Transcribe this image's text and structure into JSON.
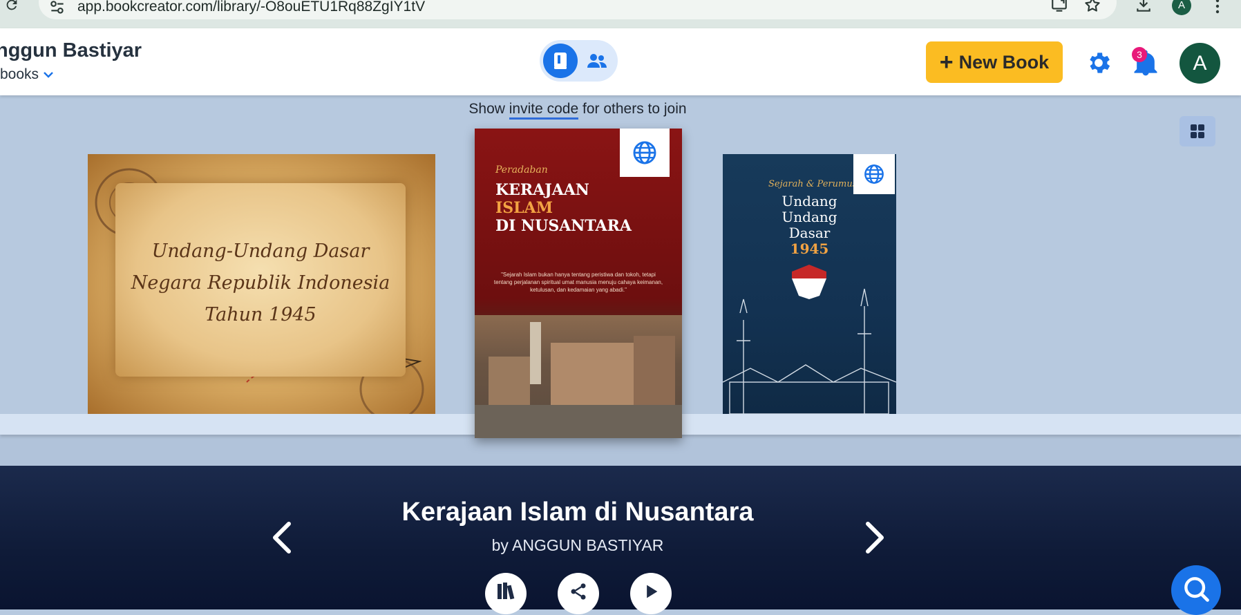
{
  "browser": {
    "url": "app.bookcreator.com/library/-O8ouETU1Rq88ZgIY1tV",
    "profile_initial": "A",
    "icons": [
      "reload-icon",
      "tune-icon",
      "cast-icon",
      "star-icon",
      "download-icon",
      "kebab-menu-icon"
    ]
  },
  "header": {
    "owner_name": "nggun Bastiyar",
    "library_filter": "books",
    "view_toggle": [
      "books-view-icon",
      "people-view-icon"
    ],
    "new_book_label": "New Book",
    "new_book_plus": "+",
    "notification_count": "3",
    "avatar_initial": "A"
  },
  "shelf": {
    "invite_prefix": "Show ",
    "invite_link": "invite code",
    "invite_suffix": " for others to join",
    "books": [
      {
        "cover_lines": [
          "Undang-Undang Dasar",
          "Negara Republik Indonesia",
          "Tahun 1945"
        ]
      },
      {
        "kicker": "Peradaban",
        "title_lines": [
          "KERAJAAN",
          "ISLAM",
          "DI NUSANTARA"
        ],
        "quote": "\"Sejarah Islam bukan hanya tentang peristiwa dan tokoh, tetapi tentang perjalanan spiritual umat manusia menuju cahaya keimanan, ketulusan, dan kedamaian yang abadi.\""
      },
      {
        "kicker": "Sejarah & Perumus",
        "title_lines": [
          "Undang",
          "Undang",
          "Dasar",
          "1945"
        ]
      }
    ]
  },
  "selected_book": {
    "title": "Kerajaan Islam di Nusantara",
    "author": "by ANGGUN BASTIYAR"
  },
  "colors": {
    "accent": "#1a73e8",
    "new_book": "#fbbc22",
    "badge": "#e8197a",
    "avatar": "#13563f",
    "panel": "#14213f"
  }
}
